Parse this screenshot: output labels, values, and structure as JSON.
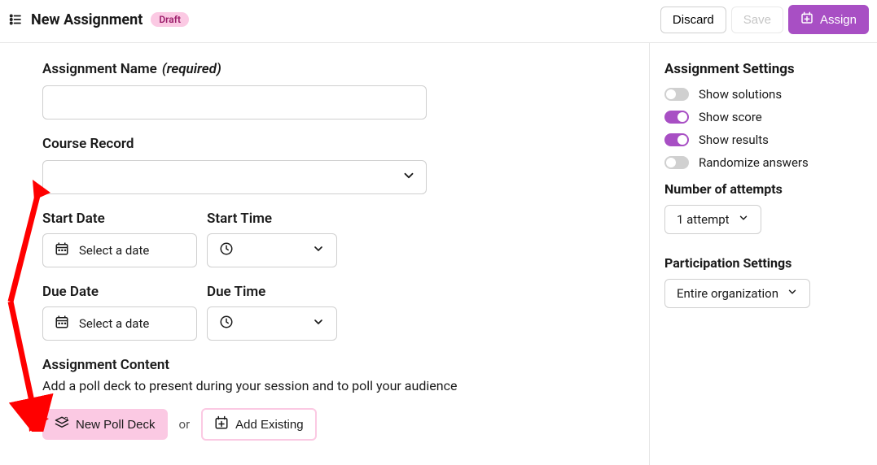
{
  "header": {
    "title": "New Assignment",
    "status": "Draft",
    "discard": "Discard",
    "save": "Save",
    "assign": "Assign"
  },
  "form": {
    "name_label": "Assignment Name",
    "name_required": "(required)",
    "name_value": "",
    "course_label": "Course Record",
    "start_date_label": "Start Date",
    "start_time_label": "Start Time",
    "due_date_label": "Due Date",
    "due_time_label": "Due Time",
    "date_placeholder": "Select a date",
    "content_title": "Assignment Content",
    "content_desc": "Add a poll deck to present during your session and to poll your audience",
    "new_poll_deck": "New Poll Deck",
    "or": "or",
    "add_existing": "Add Existing"
  },
  "settings": {
    "heading": "Assignment Settings",
    "toggles": [
      {
        "label": "Show solutions",
        "on": false
      },
      {
        "label": "Show score",
        "on": true
      },
      {
        "label": "Show results",
        "on": true
      },
      {
        "label": "Randomize answers",
        "on": false
      }
    ],
    "attempts_label": "Number of attempts",
    "attempts_value": "1 attempt",
    "participation_label": "Participation Settings",
    "participation_value": "Entire organization"
  }
}
